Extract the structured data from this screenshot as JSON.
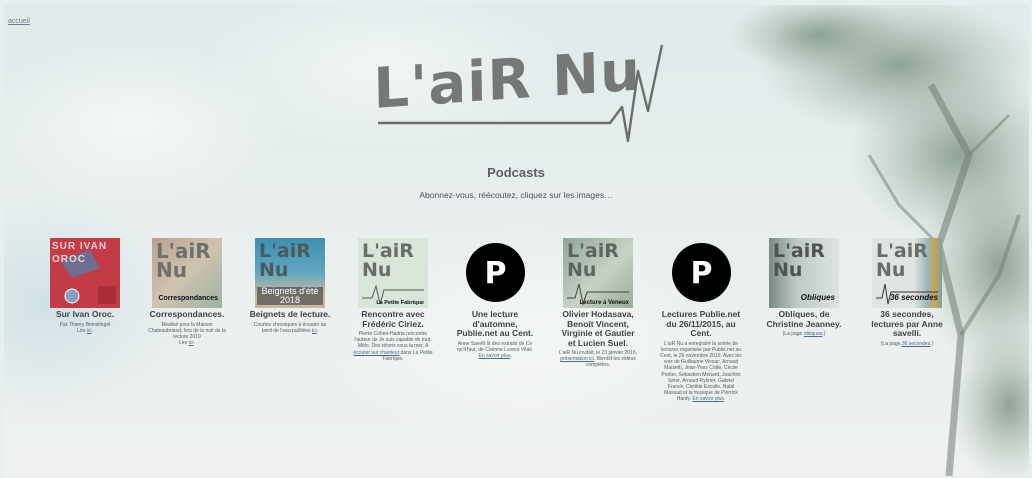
{
  "nav": {
    "home_link": "accueil"
  },
  "logo": {
    "text": "L'aiR Nu"
  },
  "section": {
    "title": "Podcasts",
    "subtitle": "Abonnez-vous, réécoutez, cliquez sur les images…"
  },
  "colors": {
    "text_dark": "#3f4447",
    "link": "#4b6a88",
    "podcast_circle": "#000000"
  },
  "podcasts": [
    {
      "thumb_text": "SUR IVAN OROC",
      "title": "Sur Ivan Oroc.",
      "desc": "Par Thierry Beinstingel",
      "link_prefix": "Lire ",
      "link": "ici",
      "link_suffix": "."
    },
    {
      "thumb_text": "L'aiR Nu",
      "thumb_label": "Correspondances",
      "title": "Correspondances.",
      "desc": "Réalisé pour la Maison Chateaubriand, lors de la nuit de la lecture 2019",
      "link_prefix": "Lire ",
      "link": "ici",
      "link_suffix": "."
    },
    {
      "thumb_text": "L'aiR Nu",
      "thumb_label": "Beignets d'été 2018",
      "title": "Beignets de lecture.",
      "desc": "Courtes chroniques à écouter au bord de l'eau publiées",
      "link_prefix": " ",
      "link": "ici",
      "link_suffix": "."
    },
    {
      "thumb_text": "L'aiR Nu",
      "thumb_label": "La Petite Fabrique",
      "title": "Rencontre avec Frédéric Ciriez.",
      "desc": "Pierre Cohen-Hadria rencontre l'auteur de Je suis capable de tout, Mélo, Des rétoris sous la mer. A",
      "link_prefix": " ",
      "link": "écouter sur chanteur",
      "link_suffix": " dans La Petite Fabrique."
    },
    {
      "thumb_text": "P",
      "title": "Une lecture d'automne, Publie.net au Cent.",
      "desc": "Anne Savelli lit des extraits de Ce qu'il faut, de Corinne Lovera Vitali.",
      "link_prefix": " ",
      "link": "En savoir plus",
      "link_suffix": "."
    },
    {
      "thumb_text": "L'aiR Nu",
      "thumb_label": "Lecture à Veneux",
      "title": "Olivier Hodasava, Benoît Vincent, Virginie et Gautier et Lucien Suel.",
      "desc": "L'aiR Nu invitait, le 23 janvier 2016,",
      "link_prefix": " ",
      "link": "présentation ici",
      "link_suffix": ". Bientôt les vidéos complètes."
    },
    {
      "thumb_text": "P",
      "title": "Lectures Publie.net du 26/11/2015, au Cent.",
      "desc": "L'aiR Nu a enregistré la soirée de lectures organisée par Publie.net au Cent, le 26 novembre 2015. Avec les voix de Guillaume Vissac, Arnaud Maïsetti, Jean-Yves Cotté, Cécile Portier, Sébastien Ménard, Joachim Séné, Arnaud Rykner, Gabriel Franck, Clotilde Escalle, Nabil Massad et la musique de Pierrick Hardy.",
      "link_prefix": " ",
      "link": "En savoir plus",
      "link_suffix": "."
    },
    {
      "thumb_text": "L'aiR Nu",
      "thumb_label": "Obliques",
      "title": "Obliques, de Christine Jeanney.",
      "desc": "(La page",
      "link_prefix": " ",
      "link": "obliques",
      "link_suffix": ".)"
    },
    {
      "thumb_text": "L'aiR Nu",
      "thumb_label": "36 secondes",
      "title": "36 secondes, lectures par Anne savelli.",
      "desc": "(La page",
      "link_prefix": " ",
      "link": "36 secondes",
      "link_suffix": ".)"
    }
  ]
}
